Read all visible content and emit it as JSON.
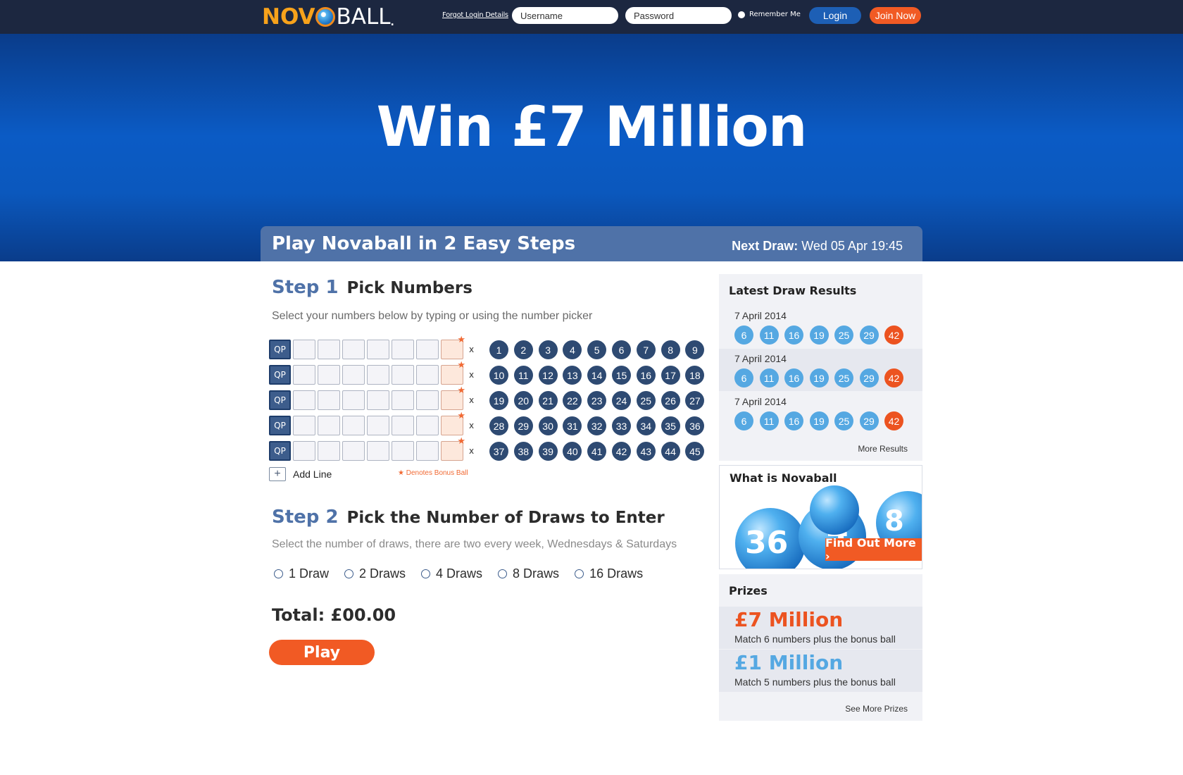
{
  "header": {
    "logo": {
      "part1": "NOV",
      "part2": "BALL",
      "tm": "."
    },
    "forgot_link": "Forgot Login Details",
    "username_placeholder": "Username",
    "password_placeholder": "Password",
    "remember_label": "Remember Me",
    "login_label": "Login",
    "join_label": "Join Now"
  },
  "hero": {
    "title": "Win £7 Million",
    "steps_title": "Play Novaball in 2 Easy Steps",
    "next_draw_label": "Next Draw:",
    "next_draw_value": "Wed 05 Apr 19:45"
  },
  "step1": {
    "number": "Step 1",
    "title": "Pick Numbers",
    "description": "Select your numbers below by typing or using the number picker",
    "qp_label": "QP",
    "x_label": "x",
    "lines": 5,
    "picker_numbers": [
      1,
      2,
      3,
      4,
      5,
      6,
      7,
      8,
      9,
      10,
      11,
      12,
      13,
      14,
      15,
      16,
      17,
      18,
      19,
      20,
      21,
      22,
      23,
      24,
      25,
      26,
      27,
      28,
      29,
      30,
      31,
      32,
      33,
      34,
      35,
      36,
      37,
      38,
      39,
      40,
      41,
      42,
      43,
      44,
      45
    ],
    "add_line_label": "Add Line",
    "add_line_icon": "+",
    "bonus_note": "★ Denotes Bonus Ball"
  },
  "step2": {
    "number": "Step 2",
    "title": "Pick the Number of Draws to Enter",
    "description": "Select the number of draws, there are two every week, Wednesdays & Saturdays",
    "options": [
      "1 Draw",
      "2 Draws",
      "4 Draws",
      "8 Draws",
      "16 Draws"
    ]
  },
  "total_label": "Total: £00.00",
  "play_label": "Play",
  "sidebar": {
    "latest": {
      "title": "Latest Draw Results",
      "results": [
        {
          "date": "7 April 2014",
          "balls": [
            6,
            11,
            16,
            19,
            25,
            29
          ],
          "bonus": 42
        },
        {
          "date": "7 April 2014",
          "balls": [
            6,
            11,
            16,
            19,
            25,
            29
          ],
          "bonus": 42
        },
        {
          "date": "7 April 2014",
          "balls": [
            6,
            11,
            16,
            19,
            25,
            29
          ],
          "bonus": 42
        }
      ],
      "more_label": "More Results"
    },
    "what": {
      "title": "What is Novaball",
      "find_more_label": "Find Out More ›"
    },
    "prizes": {
      "title": "Prizes",
      "items": [
        {
          "amount": "£7 Million",
          "desc": "Match 6 numbers plus the bonus ball",
          "color": "#ec5320"
        },
        {
          "amount": "£1 Million",
          "desc": "Match 5 numbers plus the bonus ball",
          "color": "#55a8e2"
        }
      ],
      "more_label": "See More Prizes"
    }
  },
  "colors": {
    "topbar": "#1c2740",
    "accent_orange": "#f15a24",
    "accent_blue": "#4f72a8",
    "picker_ball": "#2e4a72",
    "result_ball": "#55a8e2"
  }
}
